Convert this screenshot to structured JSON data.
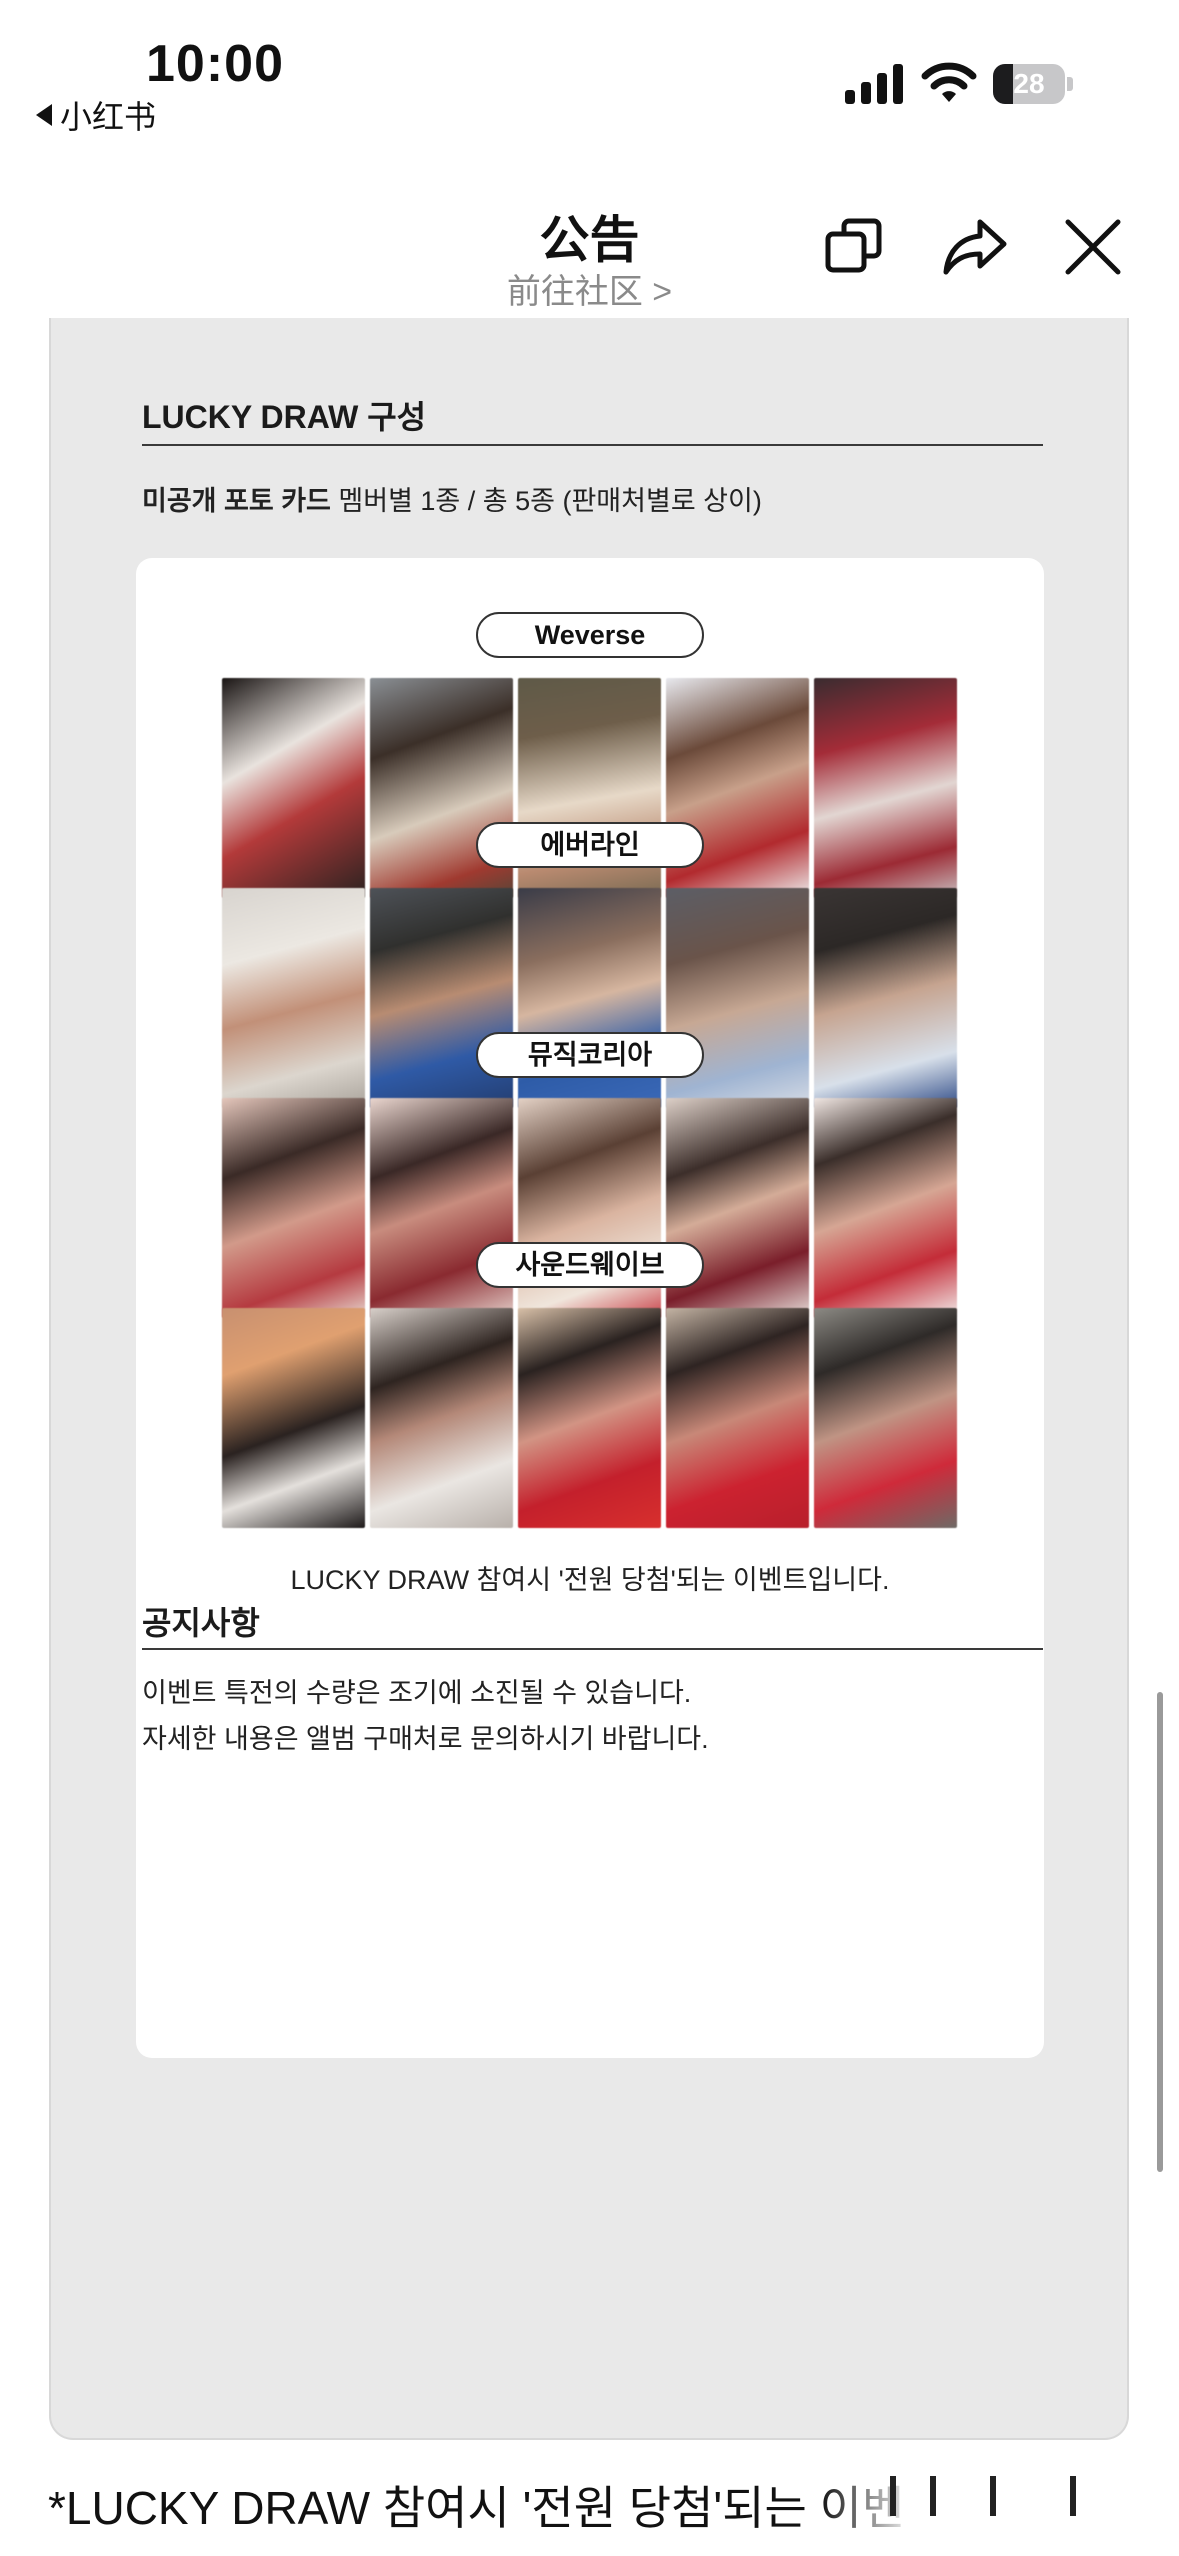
{
  "status_bar": {
    "time": "10:00",
    "back_app": "小红书",
    "battery": "28",
    "battery_level": 0.28,
    "icons": [
      "cellular-signal-icon",
      "wifi-icon",
      "battery-icon"
    ]
  },
  "header": {
    "title": "公告",
    "subtitle": "前往社区 >",
    "icons": [
      "copy-icon",
      "share-icon",
      "close-icon"
    ]
  },
  "lucky_draw": {
    "title": "LUCKY DRAW 구성",
    "desc_bold": "미공개 포토 카드",
    "desc_rest": " 멤버별 1종 / 총 5종 (판매처별로 상이)",
    "vendors": [
      {
        "name": "Weverse",
        "cards": [
          {
            "bg": "linear-gradient(150deg,#1a1514 0%,#e9e3de 35%,#b33a3a 60%,#2a2220 100%)"
          },
          {
            "bg": "linear-gradient(160deg,#8a8f94 0%,#3b2f28 30%,#d8cbbb 60%,#a03a30 85%,#554638 100%)"
          },
          {
            "bg": "linear-gradient(170deg,#5f5a48 0%,#6e5e4a 25%,#e7d9c8 55%,#b98a70 80%,#786a52 100%)"
          },
          {
            "bg": "linear-gradient(160deg,#e8e9ee 0%,#6b4a3a 30%,#c8a08a 50%,#b22a2e 75%,#eeeeee 100%)"
          },
          {
            "bg": "linear-gradient(165deg,#3a2c30 0%,#a42c38 30%,#e2d6d2 55%,#9c2a34 80%,#c9c1c2 100%)"
          }
        ]
      },
      {
        "name": "에버라인",
        "cards": [
          {
            "bg": "linear-gradient(165deg,#d8d4cf 0%,#ece8e2 30%,#c29078 55%,#dcd6ce 80%,#a8a29a 100%)"
          },
          {
            "bg": "linear-gradient(165deg,#4e5258 0%,#30302e 25%,#b88c72 50%,#2f5aa6 75%,#233d70 100%)"
          },
          {
            "bg": "linear-gradient(165deg,#3a3c48 0%,#8a6e5e 30%,#d6b6a0 50%,#2e5ca8 75%,#3b69b8 100%)"
          },
          {
            "bg": "linear-gradient(165deg,#5c5e66 0%,#6a544a 30%,#c7a894 55%,#9fb4d2 80%,#d8dde6 100%)"
          },
          {
            "bg": "linear-gradient(165deg,#3a3534 0%,#2c2826 25%,#c6a490 50%,#d8e0ea 78%,#2e4a86 100%)"
          }
        ]
      },
      {
        "name": "뮤직코리아",
        "cards": [
          {
            "bg": "linear-gradient(160deg,#e4c6bb 0%,#3a2a26 30%,#d29a8a 55%,#b53a40 80%,#e8d8d0 100%)"
          },
          {
            "bg": "linear-gradient(160deg,#ead6cf 0%,#3a2826 30%,#c88c7e 50%,#8a2a30 75%,#e6d2cc 100%)"
          },
          {
            "bg": "linear-gradient(160deg,#e4d2c6 0%,#5a4034 30%,#dab4a0 55%,#f0e6dc 80%,#c94048 100%)"
          },
          {
            "bg": "linear-gradient(160deg,#ddd0c8 0%,#3c2e2a 30%,#d4ac98 50%,#7a1e2a 75%,#e8e0dc 100%)"
          },
          {
            "bg": "linear-gradient(160deg,#f0e6e2 0%,#3a2e2a 25%,#d6a694 50%,#c42c38 75%,#f2eeec 100%)"
          }
        ]
      },
      {
        "name": "사운드웨이브",
        "cards": [
          {
            "bg": "linear-gradient(160deg,#c89070 0%,#e0a070 25%,#2a2220 55%,#e4e0dc 75%,#1e1a1a 100%)"
          },
          {
            "bg": "linear-gradient(160deg,#d8d0ca 0%,#2e2420 30%,#b48878 50%,#eae6e2 75%,#b8b0aa 100%)"
          },
          {
            "bg": "linear-gradient(160deg,#d8c0a8 0%,#2a2220 25%,#d29484 50%,#c4202c 75%,#d8302e 100%)"
          },
          {
            "bg": "linear-gradient(160deg,#c4b4a4 0%,#2e2422 25%,#c88878 50%,#cc2230 75%,#b8202c 100%)"
          },
          {
            "bg": "linear-gradient(160deg,#8c8a84 0%,#2e2a28 25%,#c09484 50%,#cf2a3a 75%,#6e6a66 100%)"
          }
        ]
      }
    ],
    "note": "LUCKY DRAW 참여시 '전원 당첨'되는 이벤트입니다."
  },
  "notice": {
    "title": "공지사항",
    "line1": "이벤트 특전의 수량은 조기에 소진될 수 있습니다.",
    "line2": "자세한 내용은 앨범 구매처로 문의하시기 바랍니다."
  },
  "bottom_caption": "*LUCKY DRAW 참여시 '전원 당첨'되는 이벤"
}
